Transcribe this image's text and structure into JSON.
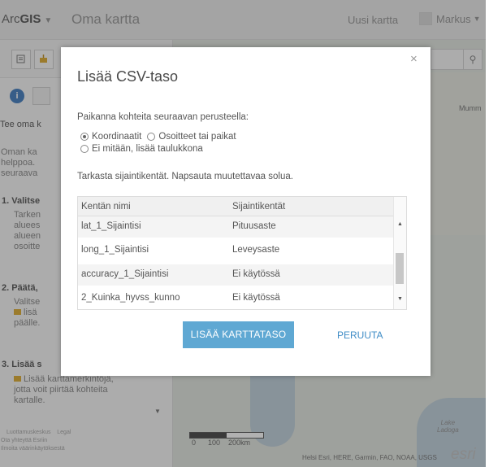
{
  "header": {
    "logo_prefix": "Arc",
    "logo_bold": "GIS",
    "map_title": "Oma kartta",
    "new_map": "Uusi kartta",
    "user": "Markus"
  },
  "left_panel": {
    "heading": "Tee oma k",
    "intro": [
      "Oman ka",
      "helppoa.",
      "seuraava"
    ],
    "step1_title": "1. Valitse",
    "step1_text": [
      "Tarken",
      "aluees",
      "alueen",
      "osoitte"
    ],
    "step2_title": "2. Päätä,",
    "step2_text": [
      "Valitse",
      "lisä",
      "päälle."
    ],
    "step3_title": "3. Lisää s",
    "step3_text": [
      "Lisää karttamerkintöjä,",
      "jotta voit piirtää kohteita",
      "kartalle."
    ],
    "footer_links": [
      "Luottamuskeskus",
      "Legal"
    ],
    "footer_lines": [
      "Ota yhteyttä Esriin",
      "Ilmoita väärinkäytöksestä"
    ]
  },
  "map": {
    "label_mumma": "Mumm",
    "lake_label": [
      "Lake",
      "Ladoga"
    ],
    "scale_labels": "0      100    200km",
    "attribution": "Helsi Esri, HERE, Garmin, FAO, NOAA, USGS",
    "esri_logo": "esri"
  },
  "dialog": {
    "title": "Lisää CSV-taso",
    "prompt": "Paikanna kohteita seuraavan perusteella:",
    "options": [
      {
        "label": "Koordinaatit",
        "selected": true
      },
      {
        "label": "Osoitteet tai paikat",
        "selected": false
      },
      {
        "label": "Ei mitään, lisää taulukkona",
        "selected": false
      }
    ],
    "instruction": "Tarkasta sijaintikentät. Napsauta muutettavaa solua.",
    "columns": [
      "Kentän nimi",
      "Sijaintikentät"
    ],
    "rows": [
      {
        "field": "lat_1_Sijaintisi",
        "location": "Pituusaste"
      },
      {
        "field": "long_1_Sijaintisi",
        "location": "Leveysaste"
      },
      {
        "field": "accuracy_1_Sijaintisi",
        "location": "Ei käytössä"
      },
      {
        "field": "2_Kuinka_hyvss_kunno",
        "location": "Ei käytössä"
      }
    ],
    "add_button": "LISÄÄ KARTTATASO",
    "cancel_button": "PERUUTA",
    "close_glyph": "×"
  },
  "colors": {
    "accent_button": "#5fa8d3",
    "link": "#3f8cc6",
    "info_icon": "#2d6fb8"
  }
}
